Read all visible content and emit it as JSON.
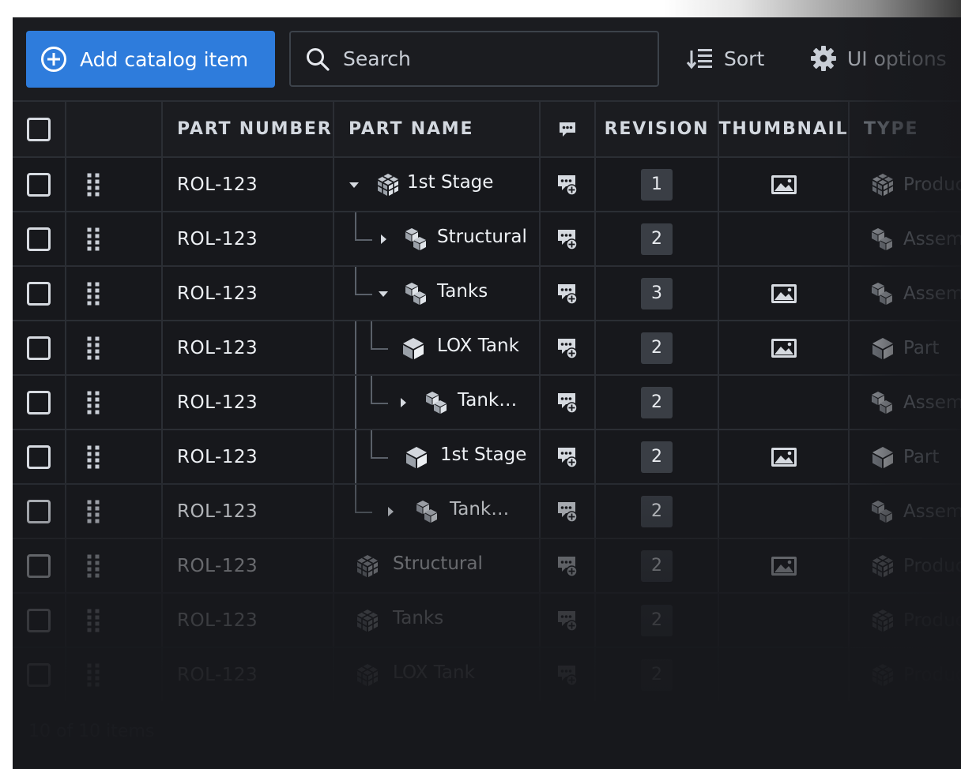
{
  "toolbar": {
    "add_label": "Add catalog item",
    "search_placeholder": "Search",
    "sort_label": "Sort",
    "ui_options_label": "UI options"
  },
  "table": {
    "headers": {
      "part_number": "PART NUMBER",
      "part_name": "PART NAME",
      "revision": "REVISION",
      "thumbnail": "THUMBNAIL",
      "type": "TYPE"
    },
    "rows": [
      {
        "part_number": "ROL-123",
        "name": "1st Stage",
        "revision": "1",
        "type": "Product",
        "thumbnail": true,
        "icon": "product",
        "expand": "expanded"
      },
      {
        "part_number": "ROL-123",
        "name": "Structural",
        "revision": "2",
        "type": "Assembly",
        "thumbnail": false,
        "icon": "assembly",
        "expand": "collapsed"
      },
      {
        "part_number": "ROL-123",
        "name": "Tanks",
        "revision": "3",
        "type": "Assembly",
        "thumbnail": true,
        "icon": "assembly",
        "expand": "expanded"
      },
      {
        "part_number": "ROL-123",
        "name": "LOX Tank",
        "revision": "2",
        "type": "Part",
        "thumbnail": true,
        "icon": "part",
        "expand": "none"
      },
      {
        "part_number": "ROL-123",
        "name": "Tank…",
        "revision": "2",
        "type": "Assembly",
        "thumbnail": false,
        "icon": "assembly",
        "expand": "collapsed"
      },
      {
        "part_number": "ROL-123",
        "name": "1st Stage",
        "revision": "2",
        "type": "Part",
        "thumbnail": true,
        "icon": "part",
        "expand": "none"
      },
      {
        "part_number": "ROL-123",
        "name": "Tank…",
        "revision": "2",
        "type": "Assembly",
        "thumbnail": false,
        "icon": "assembly",
        "expand": "collapsed"
      },
      {
        "part_number": "ROL-123",
        "name": "Structural",
        "revision": "2",
        "type": "Product",
        "thumbnail": true,
        "icon": "product",
        "expand": "none"
      },
      {
        "part_number": "ROL-123",
        "name": "Tanks",
        "revision": "2",
        "type": "Product",
        "thumbnail": false,
        "icon": "product",
        "expand": "none"
      },
      {
        "part_number": "ROL-123",
        "name": "LOX Tank",
        "revision": "2",
        "type": "Product",
        "thumbnail": false,
        "icon": "product",
        "expand": "none"
      }
    ]
  },
  "footer": {
    "count_text": "10 of 10 items"
  },
  "colors": {
    "primary": "#2e7cdc",
    "background": "#17181c",
    "border": "#2b2e34"
  }
}
